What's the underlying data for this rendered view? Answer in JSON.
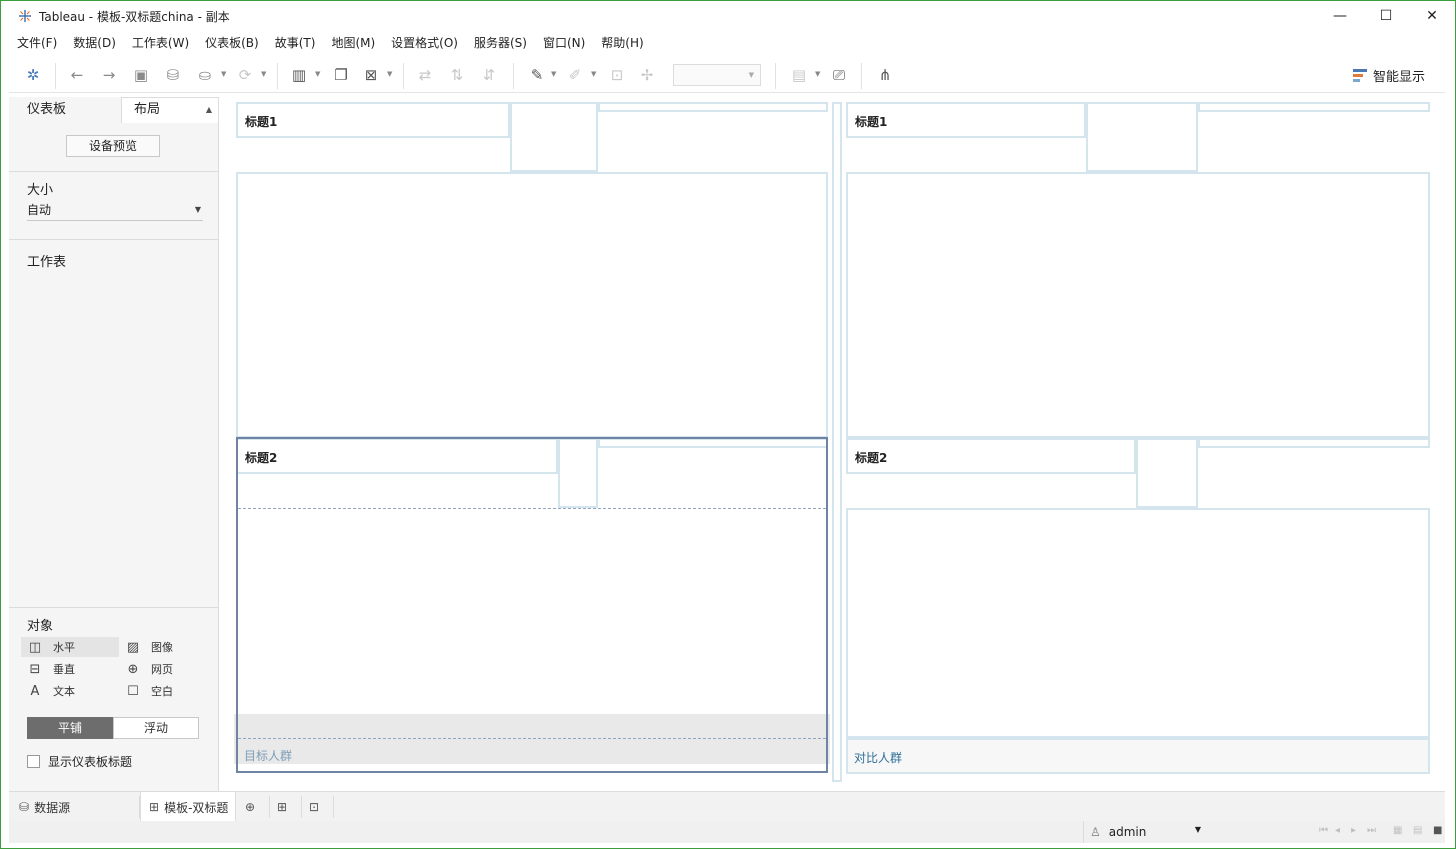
{
  "window": {
    "title": "Tableau - 模板-双标题china - 副本",
    "minimize": "—",
    "maximize": "☐",
    "close": "✕"
  },
  "menu": [
    "文件(F)",
    "数据(D)",
    "工作表(W)",
    "仪表板(B)",
    "故事(T)",
    "地图(M)",
    "设置格式(O)",
    "服务器(S)",
    "窗口(N)",
    "帮助(H)"
  ],
  "toolbar": {
    "smart_show": "智能显示"
  },
  "left_panel": {
    "tab_dashboard": "仪表板",
    "tab_layout": "布局",
    "device_preview": "设备预览",
    "size_label": "大小",
    "size_value": "自动",
    "worksheets_label": "工作表",
    "objects_label": "对象",
    "objects": [
      {
        "label": "水平",
        "icon": "horizontal-container-icon"
      },
      {
        "label": "图像",
        "icon": "image-icon"
      },
      {
        "label": "垂直",
        "icon": "vertical-container-icon"
      },
      {
        "label": "网页",
        "icon": "web-page-icon"
      },
      {
        "label": "文本",
        "icon": "text-icon"
      },
      {
        "label": "空白",
        "icon": "blank-icon"
      }
    ],
    "tiled": "平铺",
    "floating": "浮动",
    "show_dashboard_title": "显示仪表板标题"
  },
  "canvas": {
    "left_title1": "标题1",
    "left_title2": "标题2",
    "right_title1": "标题1",
    "right_title2": "标题2",
    "left_caption": "目标人群",
    "right_caption": "对比人群"
  },
  "bottom_tabs": {
    "data_source": "数据源",
    "sheet": "模板-双标题"
  },
  "status": {
    "user": "admin"
  },
  "colors": {
    "zone_border": "#d5e5ee",
    "selected_border": "#6f84a4",
    "caption_left": "#7d9db6",
    "caption_right": "#2f6f98"
  }
}
